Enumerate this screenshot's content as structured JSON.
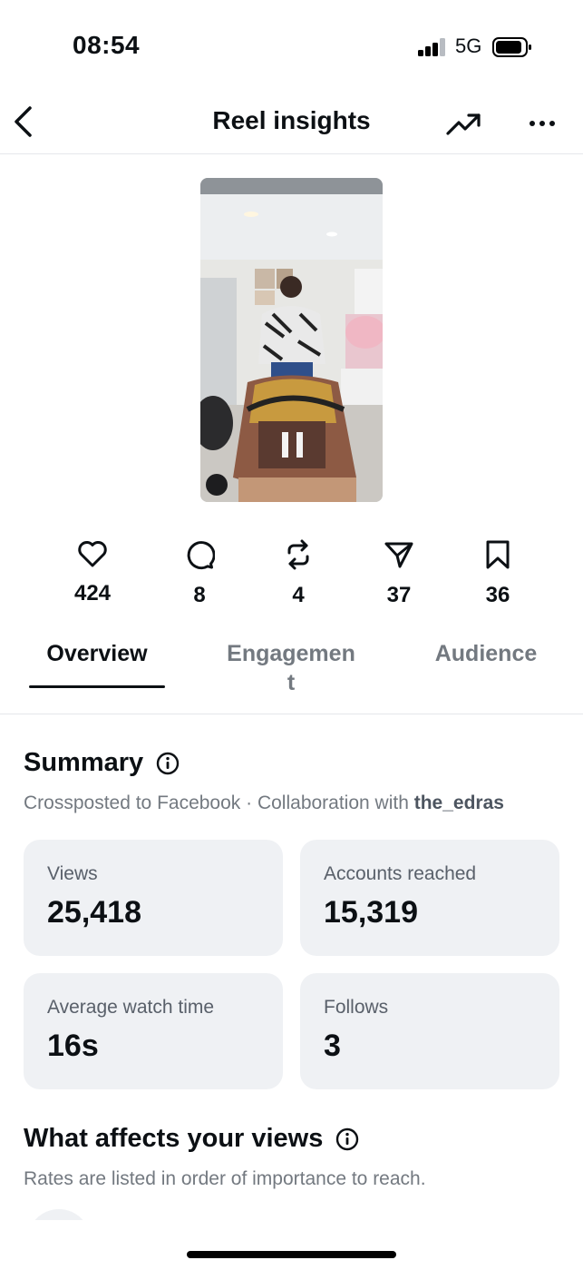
{
  "status_bar": {
    "time": "08:54",
    "network": "5G",
    "icons": [
      "signal-icon",
      "battery-icon"
    ]
  },
  "nav": {
    "title": "Reel insights",
    "icons": [
      "back-chevron-icon",
      "trending-up-icon",
      "more-dots-icon"
    ]
  },
  "reel": {
    "thumbnail": "reel-thumbnail"
  },
  "stats": [
    {
      "icon": "heart-icon",
      "value": "424"
    },
    {
      "icon": "comment-icon",
      "value": "8"
    },
    {
      "icon": "repost-icon",
      "value": "4"
    },
    {
      "icon": "share-icon",
      "value": "37"
    },
    {
      "icon": "bookmark-icon",
      "value": "36"
    }
  ],
  "tabs": [
    {
      "label": "Overview",
      "active": true
    },
    {
      "label": "Engagement",
      "label_line1": "Engagemen",
      "label_line2": "t",
      "active": false
    },
    {
      "label": "Audience",
      "active": false
    }
  ],
  "summary": {
    "title": "Summary",
    "crossposted": "Crossposted to Facebook · Collaboration with ",
    "collaborator": "the_edras",
    "cards": [
      {
        "label": "Views",
        "value": "25,418"
      },
      {
        "label": "Accounts reached",
        "value": "15,319"
      },
      {
        "label": "Average watch time",
        "value": "16s"
      },
      {
        "label": "Follows",
        "value": "3"
      }
    ]
  },
  "views_section": {
    "title": "What affects your views",
    "subtitle": "Rates are listed in order of importance to reach."
  },
  "colors": {
    "text_primary": "#0c1014",
    "text_secondary": "#737980",
    "card_bg": "#eff1f4",
    "divider": "#e5e7eb"
  }
}
